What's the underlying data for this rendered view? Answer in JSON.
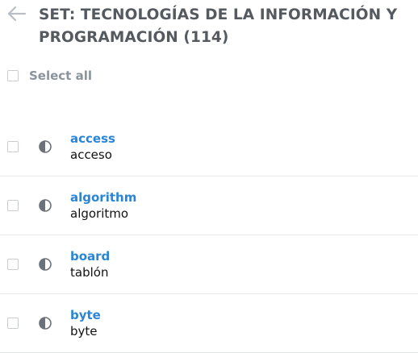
{
  "header": {
    "title": "SET: TECNOLOGÍAS DE LA INFORMACIÓN Y PROGRAMACIÓN (114)",
    "back_icon": "left-arrow-icon"
  },
  "select_all": {
    "label": "Select all"
  },
  "items": [
    {
      "term": "access",
      "definition": "acceso"
    },
    {
      "term": "algorithm",
      "definition": "algoritmo"
    },
    {
      "term": "board",
      "definition": "tablón"
    },
    {
      "term": "byte",
      "definition": "byte"
    }
  ],
  "colors": {
    "term": "#2b85d6",
    "title": "#555a60",
    "muted": "#8b939c",
    "divider": "#e6e9ec"
  }
}
